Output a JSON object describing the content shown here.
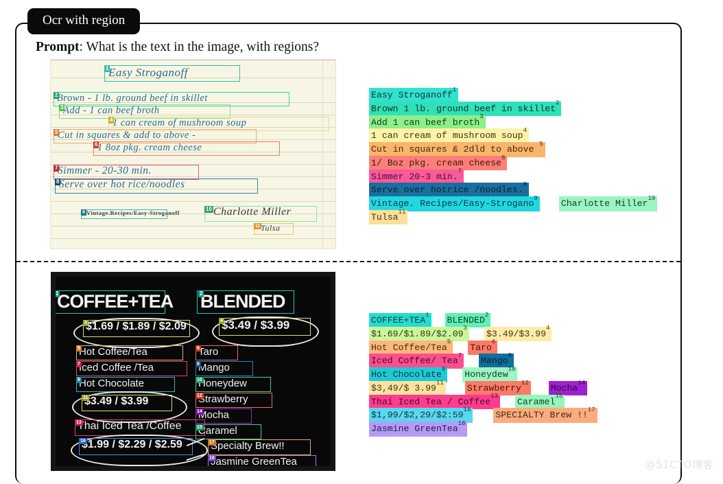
{
  "tab": {
    "label": "Ocr with region"
  },
  "prompt": {
    "bold": "Prompt",
    "rest": ": What is the text in the image, with regions?"
  },
  "watermark": {
    "text": "@51CTO博客"
  },
  "examples": [
    {
      "id": "recipe",
      "image": {
        "kind": "handwritten-recipe-card",
        "lines": [
          {
            "n": 1,
            "text": "Easy Stroganoff"
          },
          {
            "n": 2,
            "text": "Brown - 1 lb. ground beef in skillet"
          },
          {
            "n": 3,
            "text": "Add  - 1 can beef broth"
          },
          {
            "n": 4,
            "text": "1 can cream of mushroom soup"
          },
          {
            "n": 5,
            "text": "Cut in squares & add to above -"
          },
          {
            "n": 6,
            "text": "1 8oz pkg. cream cheese"
          },
          {
            "n": 7,
            "text": "Simmer - 20-30 min."
          },
          {
            "n": 8,
            "text": "Serve over hot rice/noodles"
          },
          {
            "n": 9,
            "text": "Vintage.Recipes/Easy-Stroganoff"
          },
          {
            "n": 10,
            "text": "Charlotte Miller"
          },
          {
            "n": 11,
            "text": "Tulsa"
          }
        ]
      },
      "ocr_rows": [
        [
          {
            "text": "Easy Stroganoff",
            "sup": "1",
            "bg": "#2fe3cd",
            "fg": "#11303a"
          }
        ],
        [
          {
            "text": "Brown  1 lb. ground beef in skillet",
            "sup": "2",
            "bg": "#2fe0b8",
            "fg": "#12342c"
          }
        ],
        [
          {
            "text": "Add  1 can beef broth",
            "sup": "3",
            "bg": "#8cf08a",
            "fg": "#14371a"
          }
        ],
        [
          {
            "text": "1 can cream of mushroom soup",
            "sup": "4",
            "bg": "#fdf2a8",
            "fg": "#3a3518"
          }
        ],
        [
          {
            "text": "Cut in squares & 2dld to above ",
            "sup": "5",
            "bg": "#f9b56a",
            "fg": "#45290d"
          }
        ],
        [
          {
            "text": "1/ Boz pkg. cream cheese",
            "sup": "6",
            "bg": "#fb7f76",
            "fg": "#46130f"
          }
        ],
        [
          {
            "text": "Simmer  20-3 min.",
            "sup": "7",
            "bg": "#fa5a9a",
            "fg": "#4a0f2c"
          }
        ],
        [
          {
            "text": "Serve over hotrice /noodles.",
            "sup": "8",
            "bg": "#1a6f9e",
            "fg": "#0b2433"
          }
        ],
        [
          {
            "text": "Vintage. Recipes/Easy-Strogano",
            "sup": "9",
            "bg": "#21d7e0",
            "fg": "#0d3740"
          },
          {
            "spacer": 28
          },
          {
            "text": "Charlotte Miller",
            "sup": "10",
            "bg": "#9af5c0",
            "fg": "#143a25"
          }
        ],
        [
          {
            "text": "Tulsa",
            "sup": "11",
            "bg": "#fbe09a",
            "fg": "#41341a"
          }
        ]
      ]
    },
    {
      "id": "chalkboard",
      "image": {
        "kind": "coffee-shop-chalkboard-menu",
        "left_column": [
          {
            "n": 1,
            "text": "COFFEE+TEA"
          },
          {
            "n": 3,
            "text": "$1.69 / $1.89 / $2.09"
          },
          {
            "n": 5,
            "text": "Hot Coffee/Tea"
          },
          {
            "n": 7,
            "text": "Iced Coffee /Tea"
          },
          {
            "n": 9,
            "text": "Hot Chocolate"
          },
          {
            "n": 11,
            "text": "$3.49 / $3.99"
          },
          {
            "n": 13,
            "text": "Thai Iced Tea /Coffee"
          },
          {
            "n": 16,
            "text": "$1.99 / $2.29 / $2.59"
          }
        ],
        "right_column": [
          {
            "n": 2,
            "text": "BLENDED"
          },
          {
            "n": 4,
            "text": "$3.49 / $3.99"
          },
          {
            "n": 6,
            "text": "Taro"
          },
          {
            "n": 8,
            "text": "Mango"
          },
          {
            "n": 10,
            "text": "Honeydew"
          },
          {
            "n": 12,
            "text": "Strawberry"
          },
          {
            "n": 14,
            "text": "Mocha"
          },
          {
            "n": 15,
            "text": "Caramel"
          },
          {
            "n": 17,
            "text": "Specialty Brew!!"
          },
          {
            "n": 18,
            "text": "Jasmine GreenTea"
          }
        ]
      },
      "ocr_rows": [
        [
          {
            "text": "COFFEE+TEA",
            "sup": "1",
            "bg": "#25dcd2",
            "fg": "#103a3a"
          },
          {
            "spacer": 20
          },
          {
            "text": "BLENDED",
            "sup": "2",
            "bg": "#5ef0b4",
            "fg": "#123a2a"
          }
        ],
        [
          {
            "text": "$1.69/$1.89/$2.09",
            "sup": "3",
            "bg": "#ccf59b",
            "fg": "#2b3a14"
          },
          {
            "spacer": 22
          },
          {
            "text": "$3.49/$3.99",
            "sup": "4",
            "bg": "#fdeba6",
            "fg": "#3d3417"
          }
        ],
        [
          {
            "text": "Hot Coffee/Tea",
            "sup": "5",
            "bg": "#fbb87a",
            "fg": "#452a10"
          },
          {
            "spacer": 22
          },
          {
            "text": "Taro",
            "sup": "6",
            "bg": "#fb7a68",
            "fg": "#48160f"
          }
        ],
        [
          {
            "text": "Iced Coffee/ Tea",
            "sup": "7",
            "bg": "#fb4f8f",
            "fg": "#4a0d2b"
          },
          {
            "spacer": 22
          },
          {
            "text": "Mango",
            "sup": "8",
            "bg": "#0f6f9e",
            "fg": "#06222f"
          }
        ],
        [
          {
            "text": "Hot Chocolate",
            "sup": "9",
            "bg": "#1fc9d6",
            "fg": "#0c333a"
          },
          {
            "spacer": 22
          },
          {
            "text": "Honeydew",
            "sup": "10",
            "bg": "#9df5c4",
            "fg": "#133a26"
          }
        ],
        [
          {
            "text": "$3,49/$ 3.99",
            "sup": "11",
            "bg": "#fbe39f",
            "fg": "#3e3419"
          },
          {
            "spacer": 28
          },
          {
            "text": "Strawberry",
            "sup": "12",
            "bg": "#fb7a68",
            "fg": "#48160f"
          },
          {
            "spacer": 26
          },
          {
            "text": "Mocha",
            "sup": "14",
            "bg": "#a01fd0",
            "fg": "#2e0840"
          }
        ],
        [
          {
            "text": "Thai Iced Tea / Coffee",
            "sup": "13",
            "bg": "#fb3d8e",
            "fg": "#4a0b2a"
          },
          {
            "spacer": 22
          },
          {
            "text": "Caramel",
            "sup": "15",
            "bg": "#95f5bb",
            "fg": "#133a25"
          }
        ],
        [
          {
            "text": "$1,99/$2,29/$2:59",
            "sup": "16",
            "bg": "#59d7f0",
            "fg": "#0d3440"
          },
          {
            "spacer": 30
          },
          {
            "text": "SPECIALTY Brew !!",
            "sup": "17",
            "bg": "#fbab7d",
            "fg": "#452811"
          }
        ],
        [
          {
            "text": "Jasmine GreenTea",
            "sup": "18",
            "bg": "#b49cf5",
            "fg": "#241a4a"
          }
        ]
      ]
    }
  ]
}
